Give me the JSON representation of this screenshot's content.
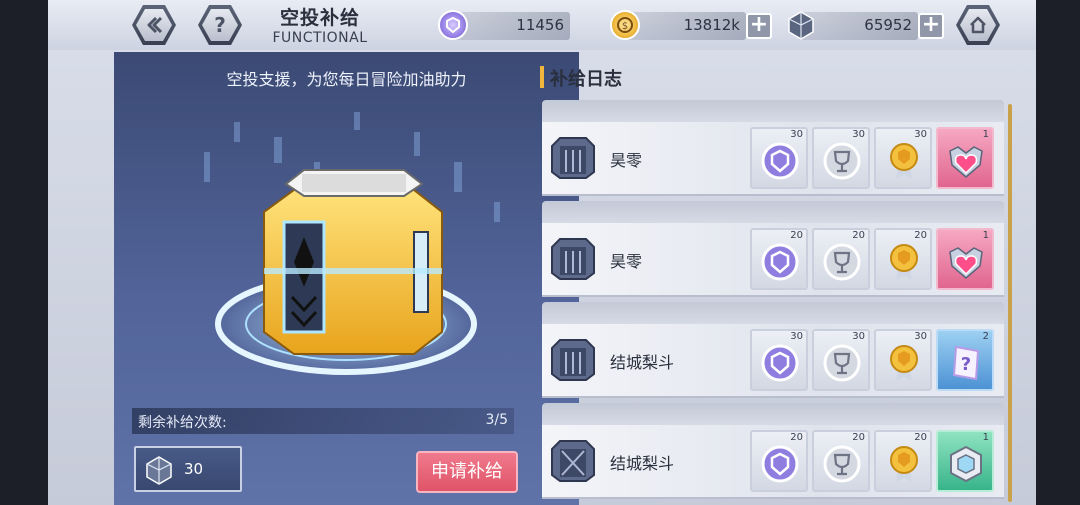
{
  "header": {
    "title": "空投补给",
    "subtitle": "FUNCTIONAL",
    "back_icon": "back-arrow-icon",
    "help_label": "?",
    "home_icon": "home-icon"
  },
  "resources": [
    {
      "icon": "purple-coin-icon",
      "value": "11456"
    },
    {
      "icon": "gold-coin-icon",
      "value": "13812k"
    },
    {
      "icon": "gem-cube-icon",
      "value": "65952"
    }
  ],
  "left": {
    "subtitle": "空投支援，为您每日冒险加油助力",
    "remain_label": "剩余补给次数:",
    "remain_value": "3/5",
    "cost_value": "30",
    "apply_button": "申请补给"
  },
  "right": {
    "title": "补给日志",
    "logs": [
      {
        "name": "昊零",
        "items": [
          {
            "type": "purple-coin",
            "count": "30"
          },
          {
            "type": "silver-trophy",
            "count": "30"
          },
          {
            "type": "gold-medal",
            "count": "30"
          },
          {
            "type": "pink-heart-emblem",
            "count": "1"
          }
        ]
      },
      {
        "name": "昊零",
        "items": [
          {
            "type": "purple-coin",
            "count": "20"
          },
          {
            "type": "silver-trophy",
            "count": "20"
          },
          {
            "type": "gold-medal",
            "count": "20"
          },
          {
            "type": "pink-heart-emblem",
            "count": "1"
          }
        ]
      },
      {
        "name": "结城梨斗",
        "items": [
          {
            "type": "purple-coin",
            "count": "30"
          },
          {
            "type": "silver-trophy",
            "count": "30"
          },
          {
            "type": "gold-medal",
            "count": "30"
          },
          {
            "type": "mystery-card",
            "count": "2"
          }
        ]
      },
      {
        "name": "结城梨斗",
        "items": [
          {
            "type": "purple-coin",
            "count": "20"
          },
          {
            "type": "silver-trophy",
            "count": "20"
          },
          {
            "type": "gold-medal",
            "count": "20"
          },
          {
            "type": "silver-hex-nut",
            "count": "1"
          }
        ]
      }
    ]
  },
  "colors": {
    "accent_pink": "#e05468",
    "panel_blue": "#52649a",
    "gold": "#f3b63c"
  }
}
